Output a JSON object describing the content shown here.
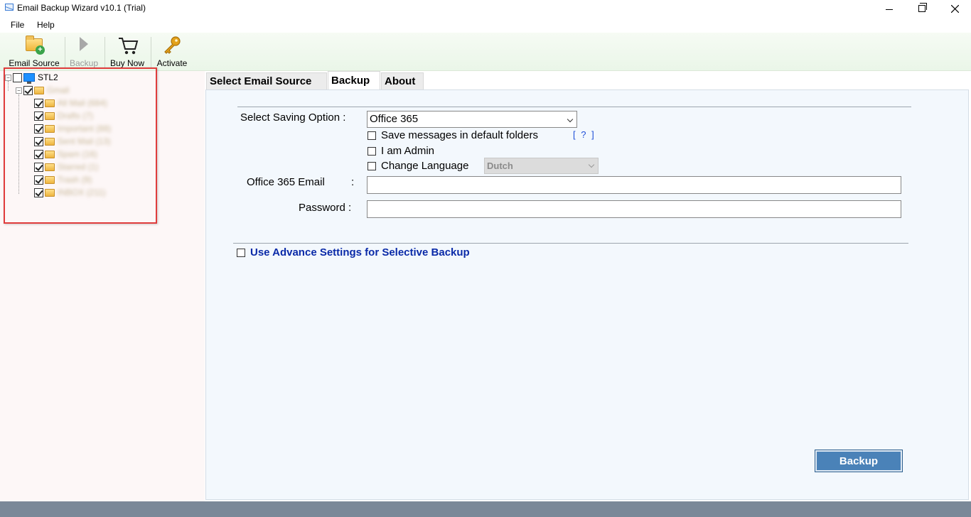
{
  "window": {
    "title": "Email Backup Wizard v10.1 (Trial)"
  },
  "menu": {
    "file": "File",
    "help": "Help"
  },
  "toolbar": {
    "email_source": "Email Source",
    "backup": "Backup",
    "buy_now": "Buy Now",
    "activate": "Activate"
  },
  "tree": {
    "root_label": "STL2",
    "account_label": "Gmail",
    "folders": [
      "All Mail (684)",
      "Drafts (7)",
      "Important (88)",
      "Sent Mail (13)",
      "Spam (16)",
      "Starred (1)",
      "Trash (9)",
      "INBOX (211)"
    ]
  },
  "tabs": {
    "select_source": "Select Email Source",
    "backup": "Backup",
    "about": "About"
  },
  "form": {
    "saving_option_label": "Select Saving Option :",
    "saving_option_value": "Office 365",
    "save_default_folders": "Save messages in default folders",
    "help_link": "[ ? ]",
    "i_am_admin": "I am Admin",
    "change_language": "Change Language",
    "language_value": "Dutch",
    "email_label": "Office 365 Email",
    "email_colon": ":",
    "email_value": "",
    "password_label": "Password :",
    "password_value": "",
    "advance_settings": "Use Advance Settings for Selective Backup",
    "backup_button": "Backup"
  },
  "colors": {
    "accent": "#4a82b8",
    "highlight": "#e03c3c",
    "link": "#0a2aa8"
  }
}
